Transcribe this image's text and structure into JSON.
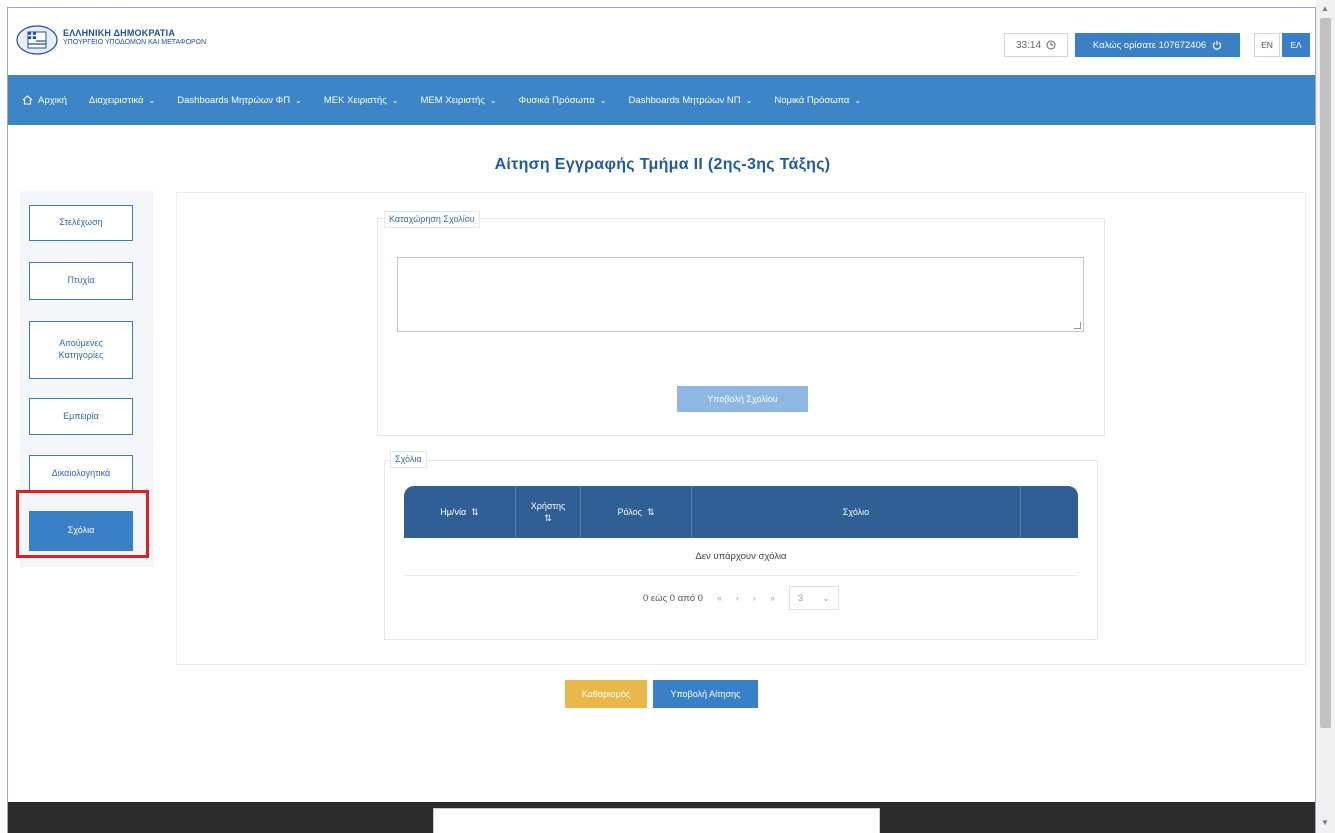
{
  "header": {
    "brand_title": "ΕΛΛΗΝΙΚΗ ΔΗΜΟΚΡΑΤΙΑ",
    "brand_subtitle": "ΥΠΟΥΡΓΕΙΟ ΥΠΟΔΟΜΩΝ ΚΑΙ ΜΕΤΑΦΟΡΩΝ",
    "clock": "33:14",
    "welcome": "Καλώς ορίσατε 107672406",
    "lang_en": "EN",
    "lang_el": "ΕΛ"
  },
  "nav": {
    "home": "Αρχική",
    "items": [
      {
        "label": "Διαχειριστικά"
      },
      {
        "label": "Dashboards Μητρώων ΦΠ"
      },
      {
        "label": "ΜΕΚ Χειριστής"
      },
      {
        "label": "ΜΕΜ Χειριστής"
      },
      {
        "label": "Φυσικά Πρόσωπα"
      },
      {
        "label": "Dashboards Μητρώων ΝΠ"
      },
      {
        "label": "Νομικά Πρόσωπα"
      }
    ]
  },
  "page_title": "Αίτηση Εγγραφής Τμήμα ΙΙ (2ης-3ης Τάξης)",
  "sidebar": {
    "items": [
      {
        "label": "Στελέχωση"
      },
      {
        "label": "Πτυχία"
      },
      {
        "label": "Αιτούμενες Κατηγορίες"
      },
      {
        "label": "Εμπειρία"
      },
      {
        "label": "Δικαιολογητικά"
      },
      {
        "label": "Σχόλια"
      }
    ]
  },
  "comment_entry": {
    "legend": "Καταχώρηση Σχολίου",
    "textarea_value": "",
    "submit_label": "Υποβολή Σχολίου"
  },
  "comments": {
    "legend": "Σχόλια",
    "columns": [
      {
        "label": "Ημ/νία",
        "sortable": true
      },
      {
        "label": "Χρήστης",
        "sortable": true
      },
      {
        "label": "Ρόλος",
        "sortable": true
      },
      {
        "label": "Σχόλιο",
        "sortable": false
      },
      {
        "label": "",
        "sortable": false
      }
    ],
    "empty_text": "Δεν υπάρχουν σχόλια",
    "pager": {
      "range": "0 εώς 0 από 0",
      "first": "«",
      "prev": "‹",
      "next": "›",
      "last": "»",
      "page_size": "3"
    }
  },
  "actions": {
    "clear": "Καθαρισμός",
    "submit": "Υποβολή Αίτησης"
  },
  "colors": {
    "primary": "#3d85c6",
    "table_header": "#2f5f94",
    "clear_button": "#e9b84a",
    "highlight": "#e02020"
  }
}
